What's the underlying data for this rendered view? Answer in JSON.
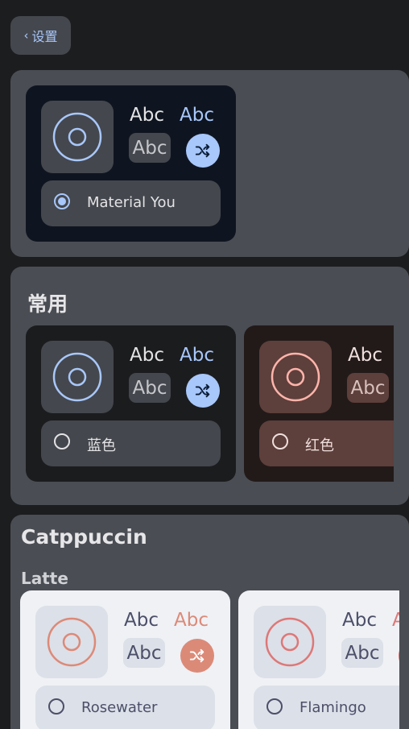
{
  "header": {
    "back_label": "设置"
  },
  "colors": {
    "accent_blue": "#a8c7fa",
    "accent_red": "#ffb4ab",
    "rosewater": "#dc8a78",
    "flamingo": "#dd7878",
    "panel": "#4a4d53",
    "background": "#1c1d1f"
  },
  "top_section": {
    "card": {
      "abc_top": "Abc",
      "abc_accent": "Abc",
      "abc_chip": "Abc",
      "label": "Material You",
      "selected": true
    }
  },
  "common": {
    "title": "常用",
    "cards": [
      {
        "abc_top": "Abc",
        "abc_accent": "Abc",
        "abc_chip": "Abc",
        "label": "蓝色",
        "selected": false
      },
      {
        "abc_top": "Abc",
        "abc_chip": "Abc",
        "label": "红色",
        "selected": false
      }
    ]
  },
  "catppuccin": {
    "title": "Catppuccin",
    "subtitle": "Latte",
    "cards": [
      {
        "abc_top": "Abc",
        "abc_accent": "Abc",
        "abc_chip": "Abc",
        "label": "Rosewater",
        "selected": false
      },
      {
        "abc_top": "Abc",
        "abc_accent": "A",
        "abc_chip": "Abc",
        "label": "Flamingo",
        "selected": false
      }
    ]
  },
  "icons": [
    "chevron-left-icon",
    "shuffle-icon",
    "palette-preview-icon",
    "radio-icon"
  ]
}
